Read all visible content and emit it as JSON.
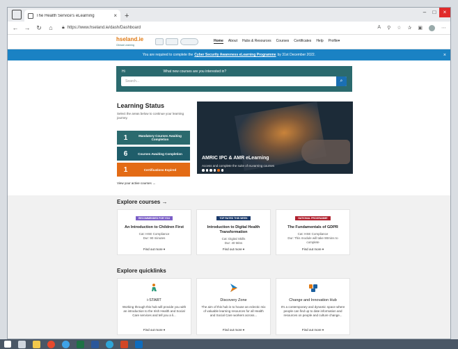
{
  "browser": {
    "tab_title": "The Health Service's eLearning",
    "tab_close": "×",
    "new_tab": "+",
    "url": "https://www.hseland.ie/dash/Dashboard",
    "win_minimize": "–",
    "win_maximize": "□",
    "win_close": "×"
  },
  "site": {
    "logo_text": "hseland.ie",
    "logo_sub": "Clinical Learning",
    "nav": [
      "Home",
      "About",
      "Hubs & Resources",
      "Courses",
      "Certificates",
      "Help",
      "Profile"
    ],
    "profile_chevron": "▾"
  },
  "banner": {
    "text_before": "You are required to complete the",
    "link": "Cyber Security Awareness eLearning Programme",
    "text_after": "by 31st December 2022.",
    "close": "×"
  },
  "hero": {
    "greeting": "Hi",
    "question": "What new courses are you interested in?",
    "search_placeholder": "Search...",
    "search_icon": "⌕"
  },
  "learning_status": {
    "title": "Learning Status",
    "description": "Select the areas below to continue your learning journey.",
    "stats": [
      {
        "count": "1",
        "label": "Mandatory Courses Awaiting Completion"
      },
      {
        "count": "6",
        "label": "Courses Awaiting Completion"
      },
      {
        "count": "1",
        "label": "Certifications Expired"
      }
    ],
    "view_active": "View your active courses →"
  },
  "feature": {
    "title": "AMRIC IPC & AMR eLearning",
    "subtitle": "Access and complete the suite of eLearning courses",
    "slides": 6,
    "active_slide": 5
  },
  "explore_courses": {
    "title": "Explore courses →",
    "cards": [
      {
        "tag": "RECOMMENDED FOR YOU",
        "tag_color": "#7b5fc7",
        "title": "An Introduction to Children First",
        "meta": [
          "Cat: HSE Compliance",
          "Dur: 90 minutes"
        ],
        "more": "Find out more ▾"
      },
      {
        "tag": "TOP RATED THIS WEEK",
        "tag_color": "#1b3a6b",
        "title": "Introduction to Digital Health Transformation",
        "meta": [
          "Cat: Digital Skills",
          "Dur: 40 Mins"
        ],
        "more": "Find out more ▾"
      },
      {
        "tag": "NATIONAL PROGRAMME",
        "tag_color": "#b0212e",
        "title": "The Fundamentals of GDPR",
        "meta": [
          "Cat: HSE Compliance",
          "Dur: This module will take 90mins to complete"
        ],
        "more": "Find out more ▾"
      }
    ]
  },
  "explore_quicklinks": {
    "title": "Explore quicklinks",
    "cards": [
      {
        "title": "i-START",
        "desc": "Working through this hub will provide you with an introduction to the Irish Health and Social Care services and tell you a li...",
        "more": "Find out more ▾",
        "icon": "person-icon",
        "icon_color": "#e07a14"
      },
      {
        "title": "Discovery Zone",
        "desc": "The aim of this hub is to house an eclectic mix of valuable learning resources for all Health and Social Care workers across...",
        "more": "Find out more ▾",
        "icon": "discovery-icon",
        "icon_color": "#1a82c4"
      },
      {
        "title": "Change and Innovation Hub",
        "desc": "It's a contemporary and dynamic space where people can find up to date information and resources on people and culture change...",
        "more": "Find out more ▾",
        "icon": "change-icon",
        "icon_color": "#1b5f9e"
      }
    ]
  },
  "colors": {
    "teal": "#2b6a6e",
    "orange": "#e36b15",
    "banner_blue": "#1a82c4"
  }
}
